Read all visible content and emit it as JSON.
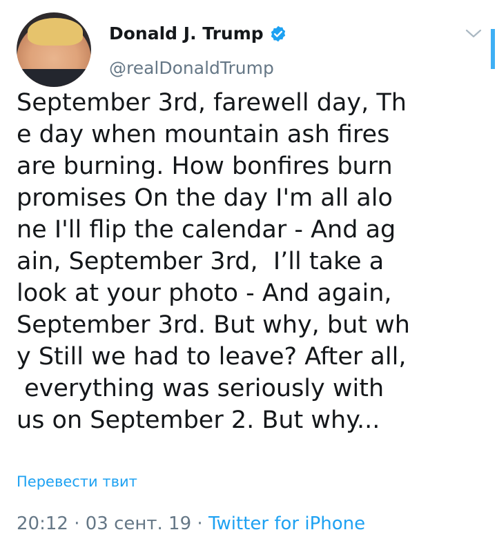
{
  "author": {
    "name": "Donald J. Trump",
    "handle": "@realDonaldTrump",
    "verified": true
  },
  "tweet": {
    "lines": [
      "September 3rd, farewell day, Th",
      "e day when mountain ash fires",
      "are burning. How bonfires burn",
      "promises On the day I'm all alo",
      "ne I'll flip the calendar - And ag",
      "ain, September 3rd,  I’ll take a",
      "look at your photo - And again,",
      "September 3rd. But why, but wh",
      "y Still we had to leave? After all,",
      " everything was seriously with",
      "us on September 2. But why..."
    ]
  },
  "translate_label": "Перевести твит",
  "meta": {
    "time": "20:12",
    "sep1": " · ",
    "date": "03 сент. 19",
    "sep2": " · ",
    "source": "Twitter for iPhone"
  },
  "colors": {
    "accent": "#1da1f2",
    "secondary": "#657786",
    "text": "#14171a"
  },
  "icons": {
    "verified": "verified-badge-icon",
    "chevron": "chevron-down-icon"
  }
}
